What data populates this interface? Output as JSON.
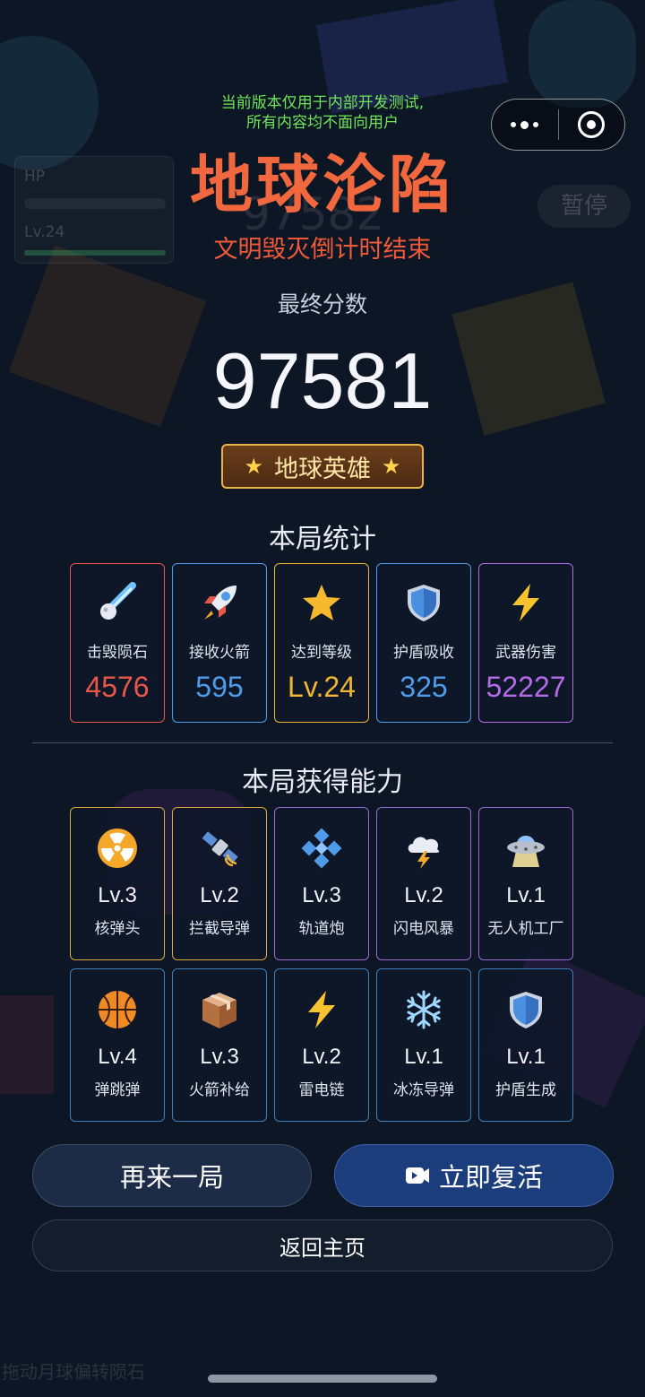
{
  "background": {
    "hud_hp_label": "HP",
    "hud_level_label": "Lv.24",
    "hud_score_ghost": "97582",
    "pause_label": "暂停",
    "drag_hint": "拖动月球偏转陨石"
  },
  "notice": {
    "line1": "当前版本仅用于内部开发测试,",
    "line2": "所有内容均不面向用户"
  },
  "header": {
    "title": "地球沦陷",
    "subtitle": "文明毁灭倒计时结束"
  },
  "score": {
    "label": "最终分数",
    "value": "97581",
    "badge": "地球英雄"
  },
  "stats": {
    "title": "本局统计",
    "items": [
      {
        "icon": "comet-icon",
        "name": "击毁陨石",
        "value": "4576",
        "color": "#e9564a"
      },
      {
        "icon": "rocket-icon",
        "name": "接收火箭",
        "value": "595",
        "color": "#4f9bea"
      },
      {
        "icon": "star-icon",
        "name": "达到等级",
        "value": "Lv.24",
        "color": "#f2b532"
      },
      {
        "icon": "shield-icon",
        "name": "护盾吸收",
        "value": "325",
        "color": "#4f9bea"
      },
      {
        "icon": "lightning-icon",
        "name": "武器伤害",
        "value": "52227",
        "color": "#b36be8"
      }
    ]
  },
  "abilities": {
    "title": "本局获得能力",
    "items": [
      {
        "icon": "radiation-icon",
        "level": "Lv.3",
        "name": "核弹头",
        "color": "#e0a93a"
      },
      {
        "icon": "satellite-icon",
        "level": "Lv.2",
        "name": "拦截导弹",
        "color": "#e0a93a"
      },
      {
        "icon": "diamond-icon",
        "level": "Lv.3",
        "name": "轨道炮",
        "color": "#9a6ad6"
      },
      {
        "icon": "thunder-cloud-icon",
        "level": "Lv.2",
        "name": "闪电风暴",
        "color": "#9a6ad6"
      },
      {
        "icon": "ufo-icon",
        "level": "Lv.1",
        "name": "无人机工厂",
        "color": "#9a6ad6"
      },
      {
        "icon": "basketball-icon",
        "level": "Lv.4",
        "name": "弹跳弹",
        "color": "#3d7fb8"
      },
      {
        "icon": "package-icon",
        "level": "Lv.3",
        "name": "火箭补给",
        "color": "#3d7fb8"
      },
      {
        "icon": "lightning-icon",
        "level": "Lv.2",
        "name": "雷电链",
        "color": "#3d7fb8"
      },
      {
        "icon": "snowflake-icon",
        "level": "Lv.1",
        "name": "冰冻导弹",
        "color": "#3d7fb8"
      },
      {
        "icon": "shield-icon",
        "level": "Lv.1",
        "name": "护盾生成",
        "color": "#3d7fb8"
      }
    ]
  },
  "buttons": {
    "retry": "再来一局",
    "revive": "立即复活",
    "home": "返回主页"
  }
}
